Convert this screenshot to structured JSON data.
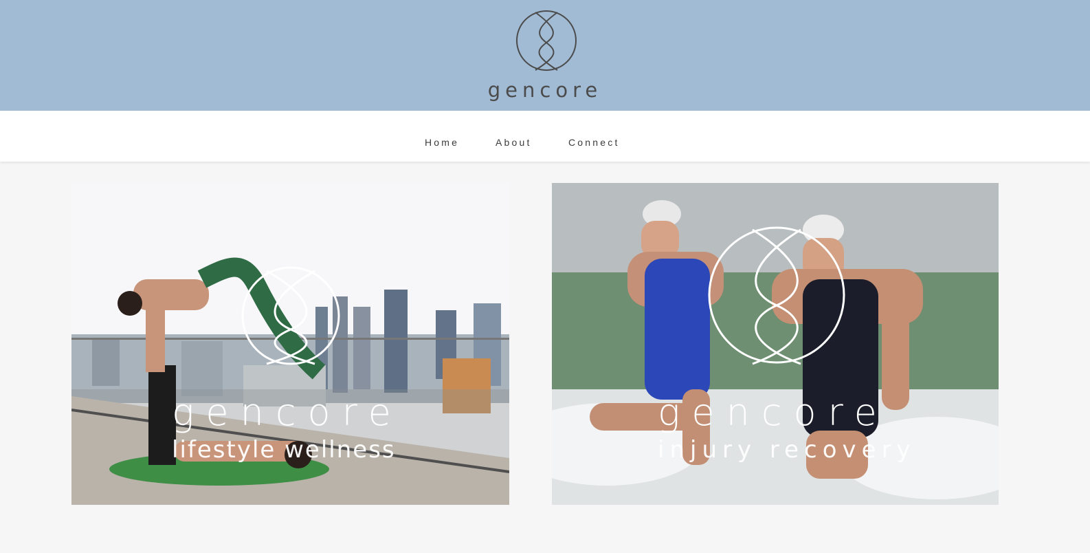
{
  "header": {
    "logo_icon": "gencore-helix-icon",
    "brand": "gencore",
    "background": "#a1bbd5"
  },
  "nav": {
    "items": [
      {
        "label": "Home"
      },
      {
        "label": "About"
      },
      {
        "label": "Connect"
      }
    ]
  },
  "cards": [
    {
      "image": "acro-yoga-rooftop-photo",
      "title": "gencore",
      "subtitle": "lifestyle wellness"
    },
    {
      "image": "triathletes-ocean-photo",
      "title": "gencore",
      "subtitle": "injury recovery"
    }
  ]
}
